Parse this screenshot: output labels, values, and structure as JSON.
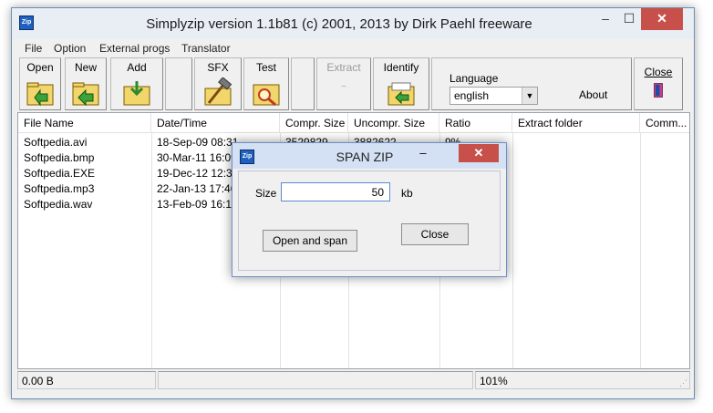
{
  "window": {
    "title": "Simplyzip version 1.1b81 (c) 2001, 2013 by Dirk Paehl freeware",
    "icon_text": "Zip",
    "minimize": "–",
    "maximize": "☐",
    "close": "✕"
  },
  "menu": [
    "File",
    "Option",
    "External progs",
    "Translator"
  ],
  "toolbar": {
    "open": "Open",
    "new": "New",
    "add": "Add",
    "sfx": "SFX",
    "test": "Test",
    "extract": "Extract",
    "identify": "Identify",
    "close": "Close",
    "language_label": "Language",
    "language_value": "english",
    "about": "About"
  },
  "table": {
    "columns": [
      "File Name",
      "Date/Time",
      "Compr. Size",
      "Uncompr. Size",
      "Ratio",
      "Extract folder",
      "Comm..."
    ],
    "rows": [
      [
        "Softpedia.avi",
        "18-Sep-09  08:31",
        "3529829",
        "3882622",
        "9%",
        "",
        ""
      ],
      [
        "Softpedia.bmp",
        "30-Mar-11  16:09",
        "",
        "",
        "",
        "",
        ""
      ],
      [
        "Softpedia.EXE",
        "19-Dec-12  12:30",
        "",
        "",
        "",
        "",
        ""
      ],
      [
        "Softpedia.mp3",
        "22-Jan-13  17:46",
        "",
        "",
        "",
        "",
        ""
      ],
      [
        "Softpedia.wav",
        "13-Feb-09  16:12",
        "",
        "",
        "",
        "",
        ""
      ]
    ]
  },
  "status": {
    "size": "0.00 B",
    "ratio": "101%"
  },
  "dialog": {
    "title": "SPAN ZIP",
    "icon_text": "Zip",
    "size_label": "Size",
    "size_value": "50",
    "unit": "kb",
    "open_and_span": "Open and span",
    "close": "Close",
    "minimize": "–",
    "close_x": "✕"
  },
  "colors": {
    "title_close_red": "#c7504a",
    "dialog_border": "#6f8fc9",
    "input_focus": "#5b8ad6"
  }
}
